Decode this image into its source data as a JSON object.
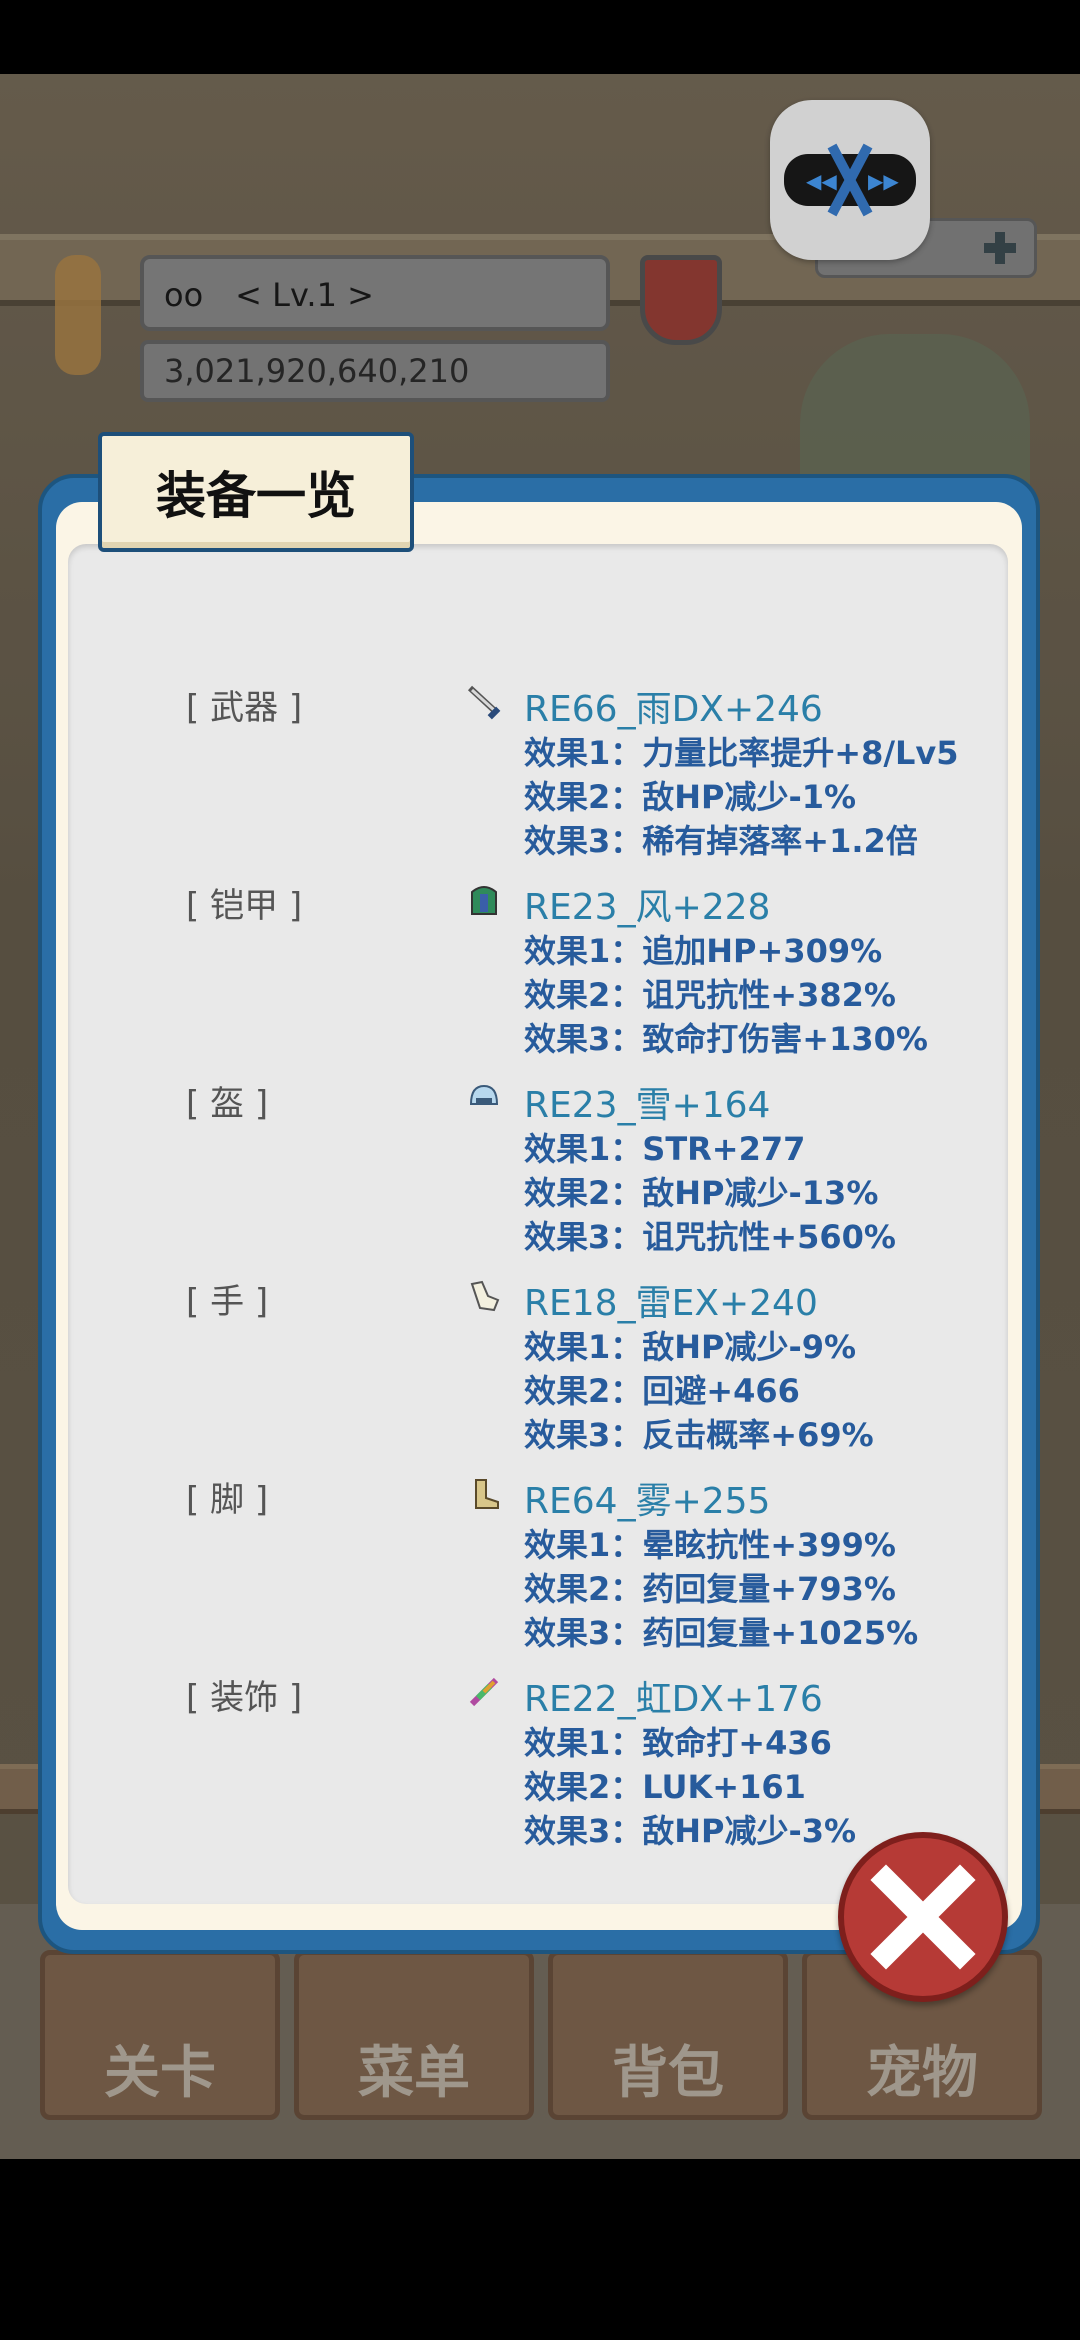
{
  "hud": {
    "player_name": "oo　< Lv.1 >",
    "gold": "3,021,920,640,210"
  },
  "tabs": [
    {
      "label": "关卡"
    },
    {
      "label": "菜单"
    },
    {
      "label": "背包"
    },
    {
      "label": "宠物"
    }
  ],
  "dialog": {
    "title": "装备一览",
    "slots": [
      {
        "label": "[ 武器 ]",
        "icon": "sword-icon",
        "name": "RE66_雨DX+246",
        "effects": [
          "效果1：力量比率提升+8/Lv5",
          "效果2：敌HP减少-1%",
          "效果3：稀有掉落率+1.2倍"
        ]
      },
      {
        "label": "[ 铠甲 ]",
        "icon": "armor-icon",
        "name": "RE23_风+228",
        "effects": [
          "效果1：追加HP+309%",
          "效果2：诅咒抗性+382%",
          "效果3：致命打伤害+130%"
        ]
      },
      {
        "label": "[ 盔 ]",
        "icon": "helmet-icon",
        "name": "RE23_雪+164",
        "effects": [
          "效果1：STR+277",
          "效果2：敌HP减少-13%",
          "效果3：诅咒抗性+560%"
        ]
      },
      {
        "label": "[ 手 ]",
        "icon": "glove-icon",
        "name": "RE18_雷EX+240",
        "effects": [
          "效果1：敌HP减少-9%",
          "效果2：回避+466",
          "效果3：反击概率+69%"
        ]
      },
      {
        "label": "[ 脚 ]",
        "icon": "boot-icon",
        "name": "RE64_雾+255",
        "effects": [
          "效果1：晕眩抗性+399%",
          "效果2：药回复量+793%",
          "效果3：药回复量+1025%"
        ]
      },
      {
        "label": "[ 装饰 ]",
        "icon": "feather-icon",
        "name": "RE22_虹DX+176",
        "effects": [
          "效果1：致命打+436",
          "效果2：LUK+161",
          "效果3：敌HP减少-3%"
        ]
      }
    ]
  },
  "colors": {
    "dialog_frame": "#2a6ea6",
    "item_name": "#2a7fa8",
    "effect_text": "#275b9c",
    "close_button": "#b63a36"
  }
}
